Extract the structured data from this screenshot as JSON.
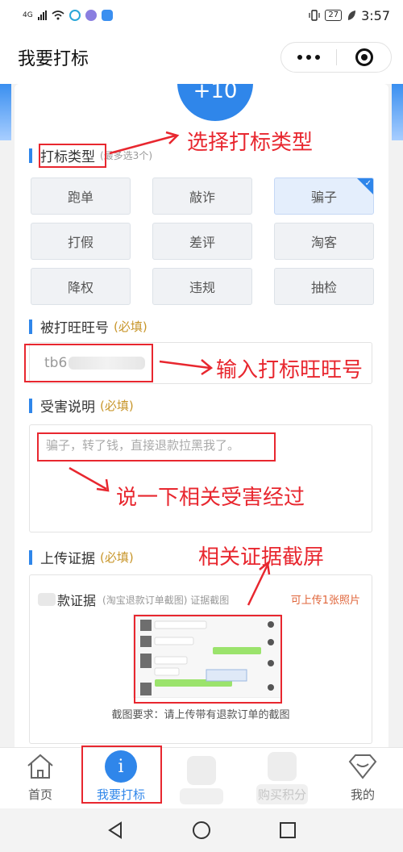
{
  "status_bar": {
    "network": "4G",
    "battery": "27",
    "time": "3:57"
  },
  "header": {
    "title": "我要打标"
  },
  "score": {
    "value": "+10"
  },
  "tag_type": {
    "title": "打标类型",
    "hint": "(最多选3个)",
    "options": [
      {
        "label": "跑单",
        "selected": false
      },
      {
        "label": "敲诈",
        "selected": false
      },
      {
        "label": "骗子",
        "selected": true
      },
      {
        "label": "打假",
        "selected": false
      },
      {
        "label": "差评",
        "selected": false
      },
      {
        "label": "淘客",
        "selected": false
      },
      {
        "label": "降权",
        "selected": false
      },
      {
        "label": "违规",
        "selected": false
      },
      {
        "label": "抽检",
        "selected": false
      }
    ]
  },
  "wangwang": {
    "title": "被打旺旺号",
    "required": "(必填)",
    "value": "tb6"
  },
  "damage": {
    "title": "受害说明",
    "required": "(必填)",
    "placeholder": "骗子，转了钱，直接退款拉黑我了。"
  },
  "evidence": {
    "title": "上传证据",
    "required": "(必填)",
    "item_title": "款证据",
    "item_sub": "(淘宝退款订单截图) 证据截图",
    "limit": "可上传1张照片",
    "caption": "截图要求：请上传带有退款订单的截图"
  },
  "annotations": {
    "select_type": "选择打标类型",
    "enter_id": "输入打标旺旺号",
    "describe": "说一下相关受害经过",
    "screenshot": "相关证据截屏"
  },
  "bottom_nav": {
    "items": [
      {
        "label": "首页"
      },
      {
        "label": "我要打标"
      },
      {
        "label": "购买积分"
      },
      {
        "label": "我的"
      }
    ]
  },
  "colors": {
    "accent": "#2f86ea",
    "annotation": "#e8272f",
    "required": "#c8962b"
  }
}
